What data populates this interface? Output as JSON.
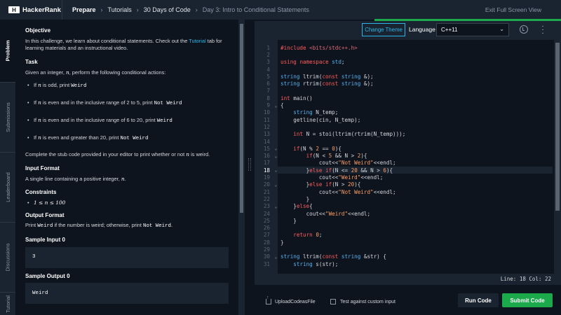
{
  "header": {
    "brand": "HackerRank",
    "logo_mark": "H",
    "crumbs": [
      "Prepare",
      "Tutorials",
      "30 Days of Code",
      "Day 3: Intro to Conditional Statements"
    ],
    "separator": "›",
    "exit_label": "Exit Full Screen View"
  },
  "sidenav": [
    "Problem",
    "Submissions",
    "Leaderboard",
    "Discussions",
    "Tutorial"
  ],
  "problem": {
    "objective_title": "Objective",
    "objective_text_1": "In this challenge, we learn about conditional statements. Check out the ",
    "objective_link": "Tutorial",
    "objective_text_2": " tab for learning materials and an instructional video.",
    "task_title": "Task",
    "task_intro_1": "Given an integer, ",
    "task_var": "n",
    "task_intro_2": ", perform the following conditional actions:",
    "conditions": [
      {
        "a": "If ",
        "v": "n",
        "b": " is odd, print ",
        "m": "Weird",
        "c": ""
      },
      {
        "a": "If ",
        "v": "n",
        "b": " is even and in the inclusive range of 2 to 5, print ",
        "m": "Not Weird",
        "c": ""
      },
      {
        "a": "If ",
        "v": "n",
        "b": " is even and in the inclusive range of 6 to 20, print ",
        "m": "Weird",
        "c": ""
      },
      {
        "a": "If ",
        "v": "n",
        "b": " is even and greater than 20, print ",
        "m": "Not Weird",
        "c": ""
      }
    ],
    "complete_1": "Complete the stub code provided in your editor to print whether or not ",
    "complete_var": "n",
    "complete_2": " is weird.",
    "input_title": "Input Format",
    "input_text_1": "A single line containing a positive integer, ",
    "input_var": "n",
    "input_text_2": ".",
    "constraints_title": "Constraints",
    "constraint": "1 ≤ n ≤ 100",
    "output_title": "Output Format",
    "output_1": "Print ",
    "output_m1": "Weird",
    "output_2": " if the number is weird; otherwise, print ",
    "output_m2": "Not Weird",
    "output_3": ".",
    "sample_input_title": "Sample Input 0",
    "sample_input": "3",
    "sample_output_title": "Sample Output 0",
    "sample_output": "Weird"
  },
  "editor": {
    "theme_button": "Change Theme",
    "language_label": "Language",
    "language_value": "C++11",
    "icons": [
      "restore-icon",
      "more-vertical-icon",
      "chevron-down-icon"
    ],
    "active_line": 18,
    "lines": [
      "#include <bits/stdc++.h>",
      "",
      "using namespace std;",
      "",
      "string ltrim(const string &);",
      "string rtrim(const string &);",
      "",
      "int main()",
      "{",
      "    string N_temp;",
      "    getline(cin, N_temp);",
      "",
      "    int N = stoi(ltrim(rtrim(N_temp)));",
      "",
      "    if(N % 2 == 0){",
      "        if(N < 5 && N > 2){",
      "            cout<<\"Not Weird\"<<endl;",
      "        }else if(N <= 20 && N > 6){",
      "            cout<<\"Weird\"<<endl;",
      "        }else if(N > 20){",
      "            cout<<\"Not Weird\"<<endl;",
      "        }",
      "    }else{",
      "        cout<<\"Weird\"<<endl;",
      "    }",
      "",
      "    return 0;",
      "}",
      "",
      "string ltrim(const string &str) {",
      "    string s(str);"
    ],
    "fold_lines": [
      9,
      15,
      16,
      18,
      20,
      23,
      30
    ],
    "status": "Line: 18 Col: 22"
  },
  "footer": {
    "upload_label": "UploadCodeasFile",
    "custom_input_label": "Test against custom input",
    "run_label": "Run Code",
    "submit_label": "Submit Code"
  },
  "colors": {
    "background": "#0e141e",
    "panel": "#1a2330",
    "accent_green": "#1ba94c",
    "link_blue": "#2bb5e8"
  }
}
